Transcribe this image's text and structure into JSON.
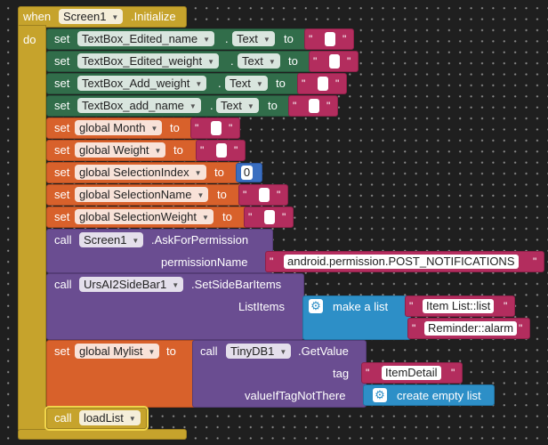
{
  "header": {
    "when": "when",
    "component": "Screen1",
    "event": ".Initialize",
    "do": "do"
  },
  "set_props": [
    {
      "set": "set",
      "component": "TextBox_Edited_name",
      "dot": ".",
      "property": "Text",
      "to": "to"
    },
    {
      "set": "set",
      "component": "TextBox_Edited_weight",
      "dot": ".",
      "property": "Text",
      "to": "to"
    },
    {
      "set": "set",
      "component": "TextBox_Add_weight",
      "dot": ".",
      "property": "Text",
      "to": "to"
    },
    {
      "set": "set",
      "component": "TextBox_add_name",
      "dot": ".",
      "property": "Text",
      "to": "to"
    }
  ],
  "globals": [
    {
      "set": "set",
      "name": "global Month",
      "to": "to"
    },
    {
      "set": "set",
      "name": "global Weight",
      "to": "to"
    },
    {
      "set": "set",
      "name": "global SelectionIndex",
      "to": "to",
      "number": "0"
    },
    {
      "set": "set",
      "name": "global SelectionName",
      "to": "to"
    },
    {
      "set": "set",
      "name": "global SelectionWeight",
      "to": "to"
    }
  ],
  "quote": {
    "open": "\"",
    "close": "\""
  },
  "ask": {
    "call": "call",
    "component": "Screen1",
    "method": ".AskForPermission",
    "param": "permissionName",
    "value": "android.permission.POST_NOTIFICATIONS"
  },
  "sidebar": {
    "call": "call",
    "component": "UrsAI2SideBar1",
    "method": ".SetSideBarItems",
    "param": "ListItems",
    "make_list": "make a list",
    "item1": "Item List::list",
    "item2": "Reminder::alarm"
  },
  "mylist": {
    "set": "set",
    "name": "global Mylist",
    "to": "to",
    "call": "call",
    "component": "TinyDB1",
    "method": ".GetValue",
    "tag_label": "tag",
    "tag_value": "ItemDetail",
    "fallback_label": "valueIfTagNotThere",
    "fallback_value": "create empty list"
  },
  "load": {
    "call": "call",
    "procedure": "loadList"
  },
  "colors": {
    "control": "#c6a32c",
    "component": "#316d4a",
    "variable": "#d8612b",
    "method": "#6a4d91",
    "text": "#b32d5e",
    "list": "#2d8fc7",
    "math": "#3a6ec0"
  }
}
